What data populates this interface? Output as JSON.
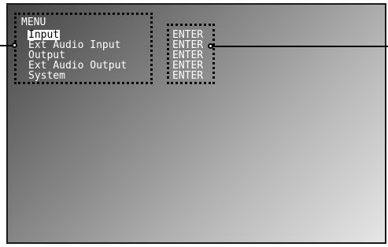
{
  "osd_menu": {
    "title": "MENU",
    "items": [
      {
        "label": "Input",
        "selected": true
      },
      {
        "label": "Ext Audio Input",
        "selected": false
      },
      {
        "label": "Output",
        "selected": false
      },
      {
        "label": "Ext Audio Output",
        "selected": false
      },
      {
        "label": "System",
        "selected": false
      }
    ],
    "actions": [
      "ENTER",
      "ENTER",
      "ENTER",
      "ENTER",
      "ENTER"
    ]
  },
  "colors": {
    "osd_text": "#ffffff",
    "selection_bg": "#ffffff",
    "selection_text": "#000000",
    "callout": "#000000"
  }
}
